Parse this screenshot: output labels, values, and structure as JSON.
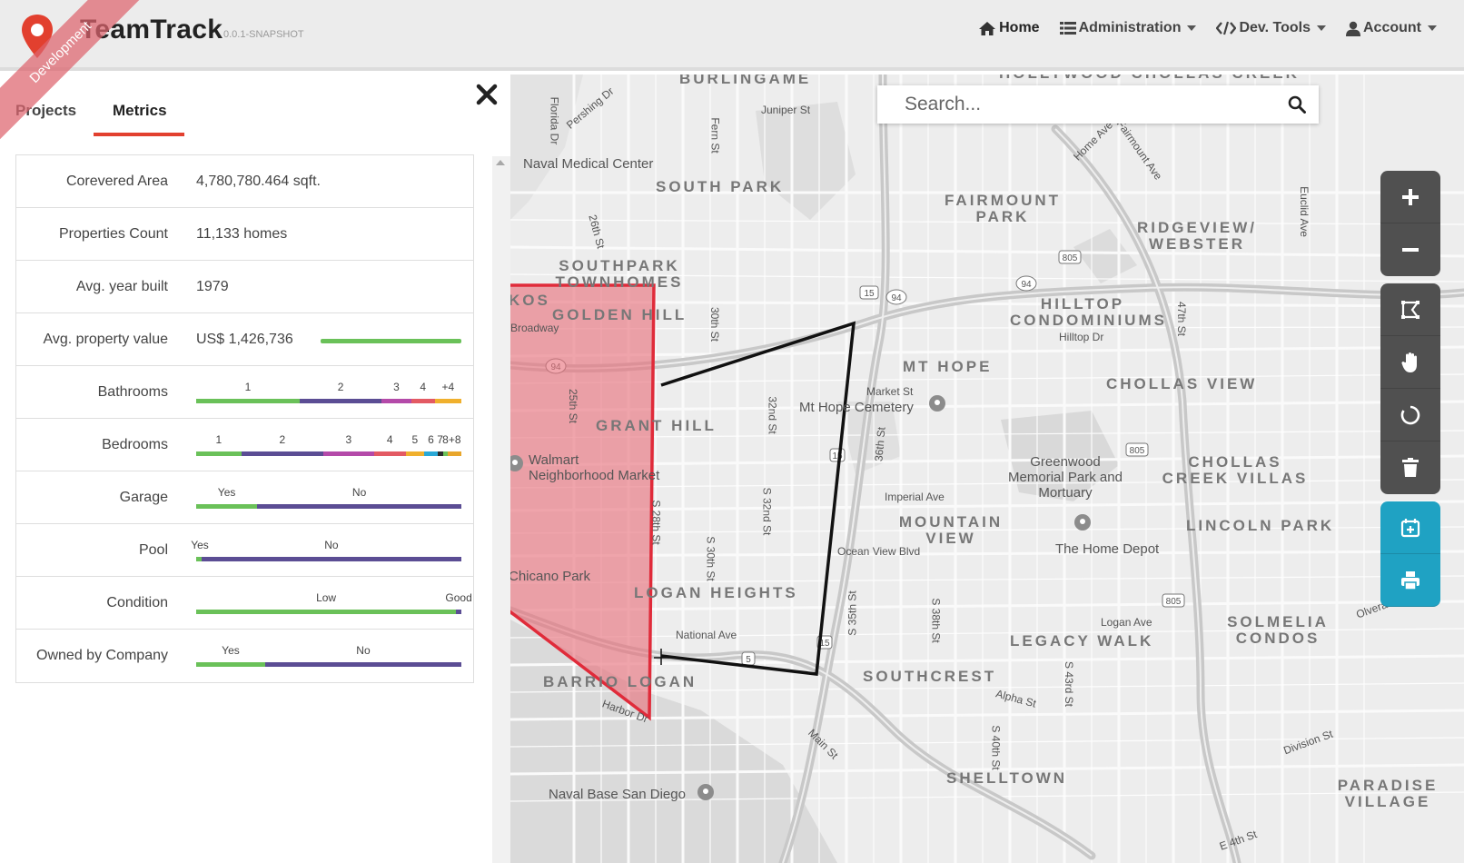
{
  "header": {
    "brand": "TeamTrack",
    "version": "0.0.1-SNAPSHOT",
    "ribbon": "Development",
    "nav": [
      {
        "label": "Home",
        "icon": "home-icon"
      },
      {
        "label": "Administration",
        "icon": "list-icon"
      },
      {
        "label": "Dev. Tools",
        "icon": "code-icon"
      },
      {
        "label": "Account",
        "icon": "user-icon"
      }
    ]
  },
  "sidebar": {
    "tabs": [
      {
        "label": "Projects"
      },
      {
        "label": "Metrics"
      }
    ],
    "active_tab": "Metrics",
    "metrics": [
      {
        "label": "Corevered Area",
        "value": "4,780,780.464 sqft."
      },
      {
        "label": "Properties Count",
        "value": "11,133 homes"
      },
      {
        "label": "Avg. year built",
        "value": "1979"
      },
      {
        "label": "Avg. property value",
        "value": "US$ 1,426,736",
        "bar_fill": 1.0
      },
      {
        "label": "Bathrooms",
        "segments": [
          {
            "label": "1",
            "share": 0.39,
            "color": "#6ac159"
          },
          {
            "label": "2",
            "share": 0.31,
            "color": "#5b4d94"
          },
          {
            "label": "3",
            "share": 0.11,
            "color": "#b44aa9"
          },
          {
            "label": "4",
            "share": 0.09,
            "color": "#e35a63"
          },
          {
            "label": "+4",
            "share": 0.1,
            "color": "#f0b02d"
          }
        ]
      },
      {
        "label": "Bedrooms",
        "segments": [
          {
            "label": "1",
            "share": 0.17,
            "color": "#6ac159"
          },
          {
            "label": "2",
            "share": 0.31,
            "color": "#5b4d94"
          },
          {
            "label": "3",
            "share": 0.19,
            "color": "#b44aa9"
          },
          {
            "label": "4",
            "share": 0.12,
            "color": "#e35a63"
          },
          {
            "label": "5",
            "share": 0.07,
            "color": "#f0b02d"
          },
          {
            "label": "6",
            "share": 0.05,
            "color": "#29a8d6"
          },
          {
            "label": "7",
            "share": 0.02,
            "color": "#2c2c2c"
          },
          {
            "label": "8",
            "share": 0.02,
            "color": "#6ac159"
          },
          {
            "label": "+8",
            "share": 0.05,
            "color": "#e8a62c"
          }
        ]
      },
      {
        "label": "Garage",
        "segments": [
          {
            "label": "Yes",
            "share": 0.23,
            "color": "#6ac159"
          },
          {
            "label": "No",
            "share": 0.77,
            "color": "#5b4d94"
          }
        ]
      },
      {
        "label": "Pool",
        "segments": [
          {
            "label": "Yes",
            "share": 0.02,
            "color": "#6ac159"
          },
          {
            "label": "No",
            "share": 0.98,
            "color": "#5b4d94"
          }
        ]
      },
      {
        "label": "Condition",
        "segments": [
          {
            "label": "Low",
            "share": 0.98,
            "color": "#6ac159"
          },
          {
            "label": "Good",
            "share": 0.02,
            "color": "#5b4d94"
          }
        ]
      },
      {
        "label": "Owned by Company",
        "segments": [
          {
            "label": "Yes",
            "share": 0.26,
            "color": "#6ac159"
          },
          {
            "label": "No",
            "share": 0.74,
            "color": "#5b4d94"
          }
        ]
      }
    ]
  },
  "map": {
    "search_placeholder": "Search...",
    "tools": [
      "zoom-in",
      "zoom-out",
      "draw-polygon",
      "pan-hand",
      "reset",
      "delete",
      "calendar-add",
      "print"
    ],
    "areas": [
      "BURLINGAME",
      "HOLLYWOOD CHOLLAS CREEK",
      "SOUTH PARK",
      "FAIRMOUNT PARK",
      "RIDGEVIEW/ WEBSTER",
      "SOUTHPARK TOWNHOMES",
      "GOLDEN HILL",
      "KOS",
      "HILLTOP CONDOMINIUMS",
      "MT HOPE",
      "CHOLLAS VIEW",
      "GRANT HILL",
      "CHOLLAS CREEK VILLAS",
      "MOUNTAIN VIEW",
      "LINCOLN PARK",
      "LOGAN HEIGHTS",
      "SOLMELIA CONDOS",
      "LEGACY WALK",
      "SOUTHCREST",
      "BARRIO LOGAN",
      "SHELLTOWN",
      "PARADISE VILLAGE"
    ],
    "pois": [
      "Naval Medical Center",
      "Mt Hope Cemetery",
      "Walmart Neighborhood Market",
      "Greenwood Memorial Park and Mortuary",
      "The Home Depot",
      "Chicano Park",
      "Naval Base San Diego"
    ],
    "streets": [
      "Pershing Dr",
      "Florida Dr",
      "Juniper St",
      "Fern St",
      "26th St",
      "25th St",
      "30th St",
      "32nd St",
      "Home Ave",
      "Fairmount Ave",
      "Euclid Ave",
      "47th St",
      "Hilltop Dr",
      "Market St",
      "36th St",
      "Imperial Ave",
      "Ocean View Blvd",
      "National Ave",
      "S 28th St",
      "S 30th St",
      "S 32nd St",
      "S 35th St",
      "S 38th St",
      "Logan Ave",
      "S 43rd St",
      "Alpha St",
      "S 40th St",
      "Harbor Dr",
      "Main St",
      "Division St",
      "E 4th St",
      "Olvera Ave",
      "Broadway"
    ],
    "highways": [
      "94",
      "15",
      "805",
      "5"
    ],
    "colors": {
      "area_fill": "#e8707a",
      "area_stroke": "#e02b3a",
      "route": "#111111"
    }
  }
}
